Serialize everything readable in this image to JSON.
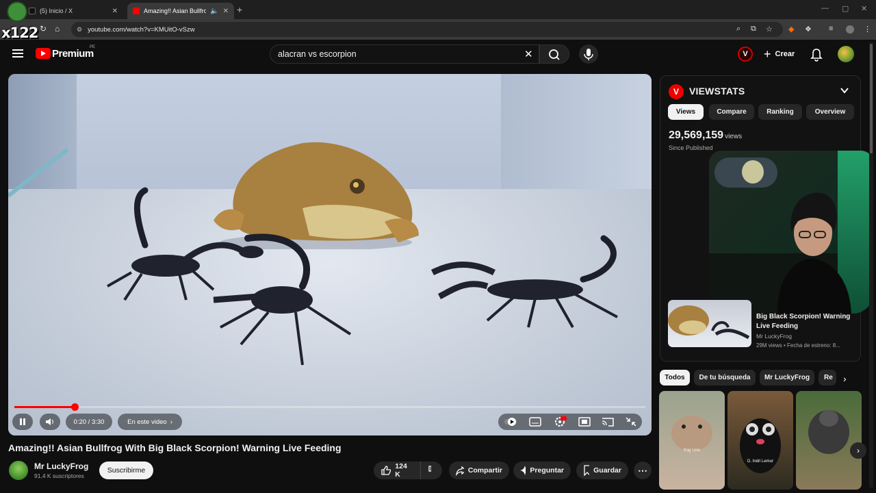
{
  "browser": {
    "tabs": [
      {
        "title": "(5) Inicio / X"
      },
      {
        "title": "Amazing!! Asian Bullfrog W"
      }
    ],
    "url": "youtube.com/watch?v=KMUitO-vSzw"
  },
  "overlay_logo": "x122",
  "header": {
    "brand": "Premium",
    "region": "PE",
    "search_query": "alacran vs escorpion",
    "create_label": "Crear"
  },
  "player": {
    "time": "0:20 / 3:30",
    "chapter": "En este video",
    "progress": 0.095
  },
  "video": {
    "title": "Amazing!! Asian Bullfrog With Big Black Scorpion! Warning Live Feeding",
    "channel": "Mr LuckyFrog",
    "subscribers": "91,4 K suscriptores",
    "subscribe_label": "Suscribirme",
    "likes": "124 K",
    "share_label": "Compartir",
    "ask_label": "Preguntar",
    "save_label": "Guardar"
  },
  "viewstats": {
    "title": "VIEWSTATS",
    "tabs": [
      "Views",
      "Compare",
      "Ranking",
      "Overview"
    ],
    "active_tab": "Views",
    "views": "29,569,159",
    "views_unit": "views",
    "since": "Since Published"
  },
  "recommended": {
    "title": "Big Black Scorpion! Warning Live Feeding",
    "channel": "Mr LuckyFrog",
    "meta": "29M views • Fecha de estreno: 8..."
  },
  "chips": [
    "Todos",
    "De tu búsqueda",
    "Mr LuckyFrog",
    "Re"
  ],
  "shorts": [
    {
      "label": "frog core"
    },
    {
      "label": "D. Indri Lemur"
    },
    {
      "label": ""
    }
  ],
  "colors": {
    "youtube_red": "#ff0000",
    "background": "#0f0f0f",
    "viewstats_red": "#e00000"
  }
}
